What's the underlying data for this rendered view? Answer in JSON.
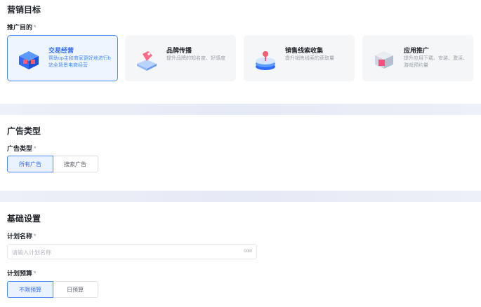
{
  "goal_section": {
    "title": "营销目标",
    "field_label": "推广目的",
    "required_mark": "*",
    "cards": [
      {
        "title": "交易经营",
        "desc": "帮助up主和商家更好地进行b站全场景电商经营",
        "icon": "shop-box-icon",
        "selected": true
      },
      {
        "title": "品牌传播",
        "desc": "提升品牌的知名度、好感度",
        "icon": "brand-tag-icon",
        "selected": false
      },
      {
        "title": "销售线索收集",
        "desc": "提升销售线索的获取量",
        "icon": "lead-stack-icon",
        "selected": false
      },
      {
        "title": "应用推广",
        "desc": "提升应用下载、安装、激活、游戏预约量",
        "icon": "app-box-icon",
        "selected": false
      }
    ]
  },
  "ad_type_section": {
    "title": "广告类型",
    "field_label": "广告类型",
    "required_mark": "*",
    "options": [
      {
        "label": "所有广告",
        "active": true
      },
      {
        "label": "搜索广告",
        "active": false
      }
    ]
  },
  "basic_section": {
    "title": "基础设置",
    "name_label": "计划名称",
    "name_required_mark": "*",
    "name_placeholder": "请输入计划名称",
    "name_counter": "0/80",
    "budget_label": "计划预算",
    "budget_required_mark": "*",
    "budget_options": [
      {
        "label": "不限预算",
        "active": true
      },
      {
        "label": "日预算",
        "active": false
      }
    ]
  },
  "colors": {
    "accent": "#2f6bff",
    "accent_border": "#4a8cff",
    "selected_bg": "#eef5ff",
    "page_bg": "#f6f8fb"
  }
}
